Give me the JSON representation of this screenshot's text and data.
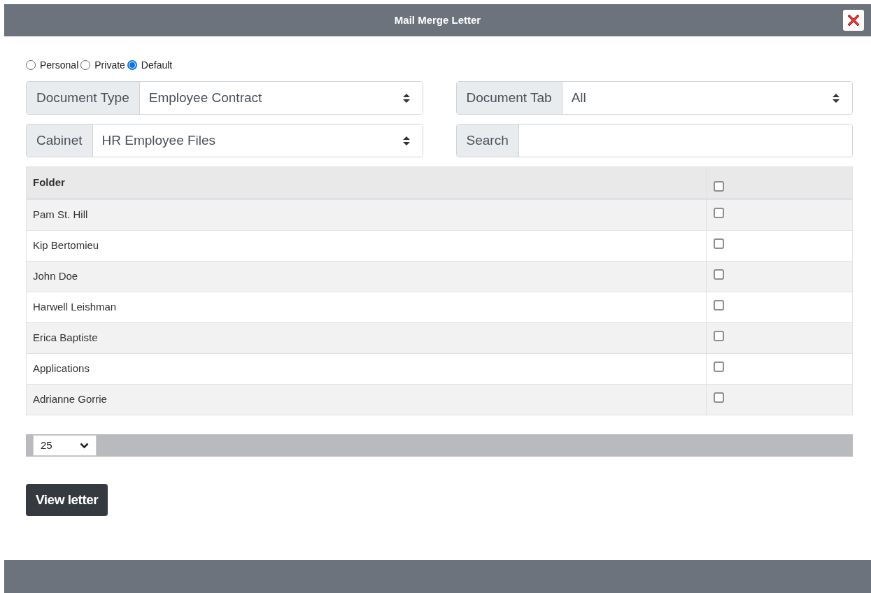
{
  "window": {
    "title": "Mail Merge Letter"
  },
  "scope_options": [
    {
      "label": "Personal",
      "selected": false
    },
    {
      "label": "Private",
      "selected": false
    },
    {
      "label": "Default",
      "selected": true
    }
  ],
  "filters": [
    {
      "kind": "select",
      "label": "Document Type",
      "value": "Employee Contract"
    },
    {
      "kind": "select",
      "label": "Document Tab",
      "value": "All"
    },
    {
      "kind": "select",
      "label": "Cabinet",
      "value": "HR Employee Files"
    },
    {
      "kind": "text",
      "label": "Search"
    }
  ],
  "table": {
    "columns": [
      "Folder"
    ],
    "select_all_checked": false,
    "rows": [
      {
        "folder": "Pam St. Hill",
        "checked": false
      },
      {
        "folder": "Kip Bertomieu",
        "checked": false
      },
      {
        "folder": "John Doe",
        "checked": false
      },
      {
        "folder": "Harwell Leishman",
        "checked": false
      },
      {
        "folder": "Erica Baptiste",
        "checked": false
      },
      {
        "folder": "Applications",
        "checked": false
      },
      {
        "folder": "Adrianne Gorrie",
        "checked": false
      }
    ]
  },
  "pager": {
    "page_size": "25"
  },
  "buttons": [
    "View letter"
  ]
}
